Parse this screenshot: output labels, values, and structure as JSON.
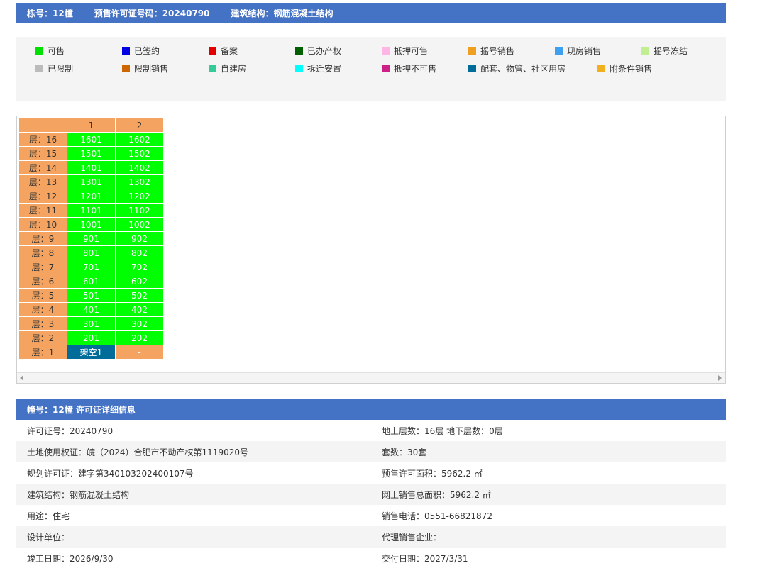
{
  "header": {
    "building": "栋号：12幢",
    "permit": "预售许可证号码：20240790",
    "structure": "建筑结构：钢筋混凝土结构"
  },
  "legend": [
    {
      "label": "可售",
      "color": "#00e000"
    },
    {
      "label": "已签约",
      "color": "#0000e0"
    },
    {
      "label": "备案",
      "color": "#e00000"
    },
    {
      "label": "已办产权",
      "color": "#006000"
    },
    {
      "label": "抵押可售",
      "color": "#ffb6e6"
    },
    {
      "label": "摇号销售",
      "color": "#f0a020"
    },
    {
      "label": "现房销售",
      "color": "#40a0f0"
    },
    {
      "label": "摇号冻结",
      "color": "#c0ee90"
    },
    {
      "label": "已限制",
      "color": "#bbbbbb"
    },
    {
      "label": "限制销售",
      "color": "#cc6600"
    },
    {
      "label": "自建房",
      "color": "#33cc99"
    },
    {
      "label": "拆迁安置",
      "color": "#00ffff"
    },
    {
      "label": "抵押不可售",
      "color": "#cc2288"
    },
    {
      "label": "配套、物管、社区用房",
      "color": "#006c99"
    },
    {
      "label": "附条件销售",
      "color": "#f0b020"
    }
  ],
  "grid": {
    "columns": [
      "",
      "1",
      "2"
    ],
    "rows": [
      {
        "floor": "层：16",
        "units": [
          "1601",
          "1602"
        ]
      },
      {
        "floor": "层：15",
        "units": [
          "1501",
          "1502"
        ]
      },
      {
        "floor": "层：14",
        "units": [
          "1401",
          "1402"
        ]
      },
      {
        "floor": "层：13",
        "units": [
          "1301",
          "1302"
        ]
      },
      {
        "floor": "层：12",
        "units": [
          "1201",
          "1202"
        ]
      },
      {
        "floor": "层：11",
        "units": [
          "1101",
          "1102"
        ]
      },
      {
        "floor": "层：10",
        "units": [
          "1001",
          "1002"
        ]
      },
      {
        "floor": "层：9",
        "units": [
          "901",
          "902"
        ]
      },
      {
        "floor": "层：8",
        "units": [
          "801",
          "802"
        ]
      },
      {
        "floor": "层：7",
        "units": [
          "701",
          "702"
        ]
      },
      {
        "floor": "层：6",
        "units": [
          "601",
          "602"
        ]
      },
      {
        "floor": "层：5",
        "units": [
          "501",
          "502"
        ]
      },
      {
        "floor": "层：4",
        "units": [
          "401",
          "402"
        ]
      },
      {
        "floor": "层：3",
        "units": [
          "301",
          "302"
        ]
      },
      {
        "floor": "层：2",
        "units": [
          "201",
          "202"
        ]
      },
      {
        "floor": "层：1",
        "units": [
          "架空1",
          "-"
        ]
      }
    ]
  },
  "detail": {
    "title": "幢号：12幢 许可证详细信息",
    "rows": [
      {
        "left": "许可证号：20240790",
        "right": "地上层数：16层  地下层数：0层"
      },
      {
        "left": "土地使用权证：皖（2024）合肥市不动产权第1119020号",
        "right": "套数：30套"
      },
      {
        "left": "规划许可证：建字第340103202400107号",
        "right": "预售许可面积：5962.2 ㎡"
      },
      {
        "left": "建筑结构：钢筋混凝土结构",
        "right": "网上销售总面积：5962.2 ㎡"
      },
      {
        "left": "用途：住宅",
        "right": "销售电话：0551-66821872"
      },
      {
        "left": "设计单位：",
        "right": "代理销售企业："
      },
      {
        "left": "竣工日期：2026/9/30",
        "right": "交付日期：2027/3/31"
      }
    ]
  }
}
